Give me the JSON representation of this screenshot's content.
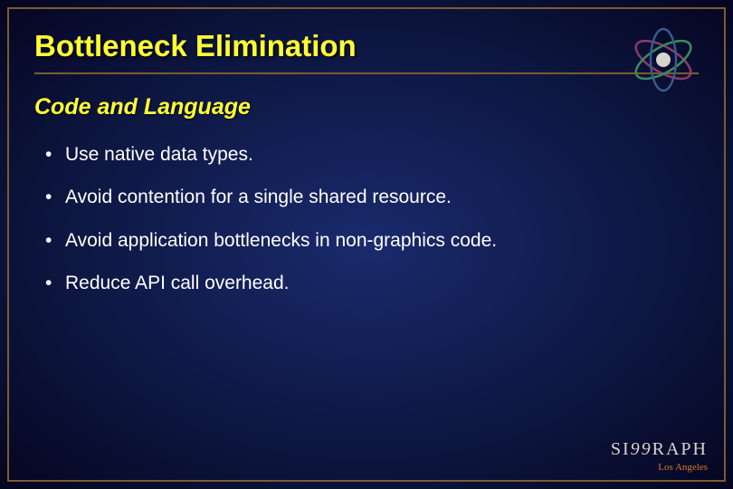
{
  "title": "Bottleneck Elimination",
  "subtitle": "Code and Language",
  "bullets": [
    "Use native data types.",
    "Avoid contention for a single shared resource.",
    "Avoid application bottlenecks in non-graphics code.",
    "Reduce API call overhead."
  ],
  "footer": {
    "brand_pre": "SI",
    "brand_mid": "99",
    "brand_post": "RAPH",
    "location": "Los Angeles"
  }
}
